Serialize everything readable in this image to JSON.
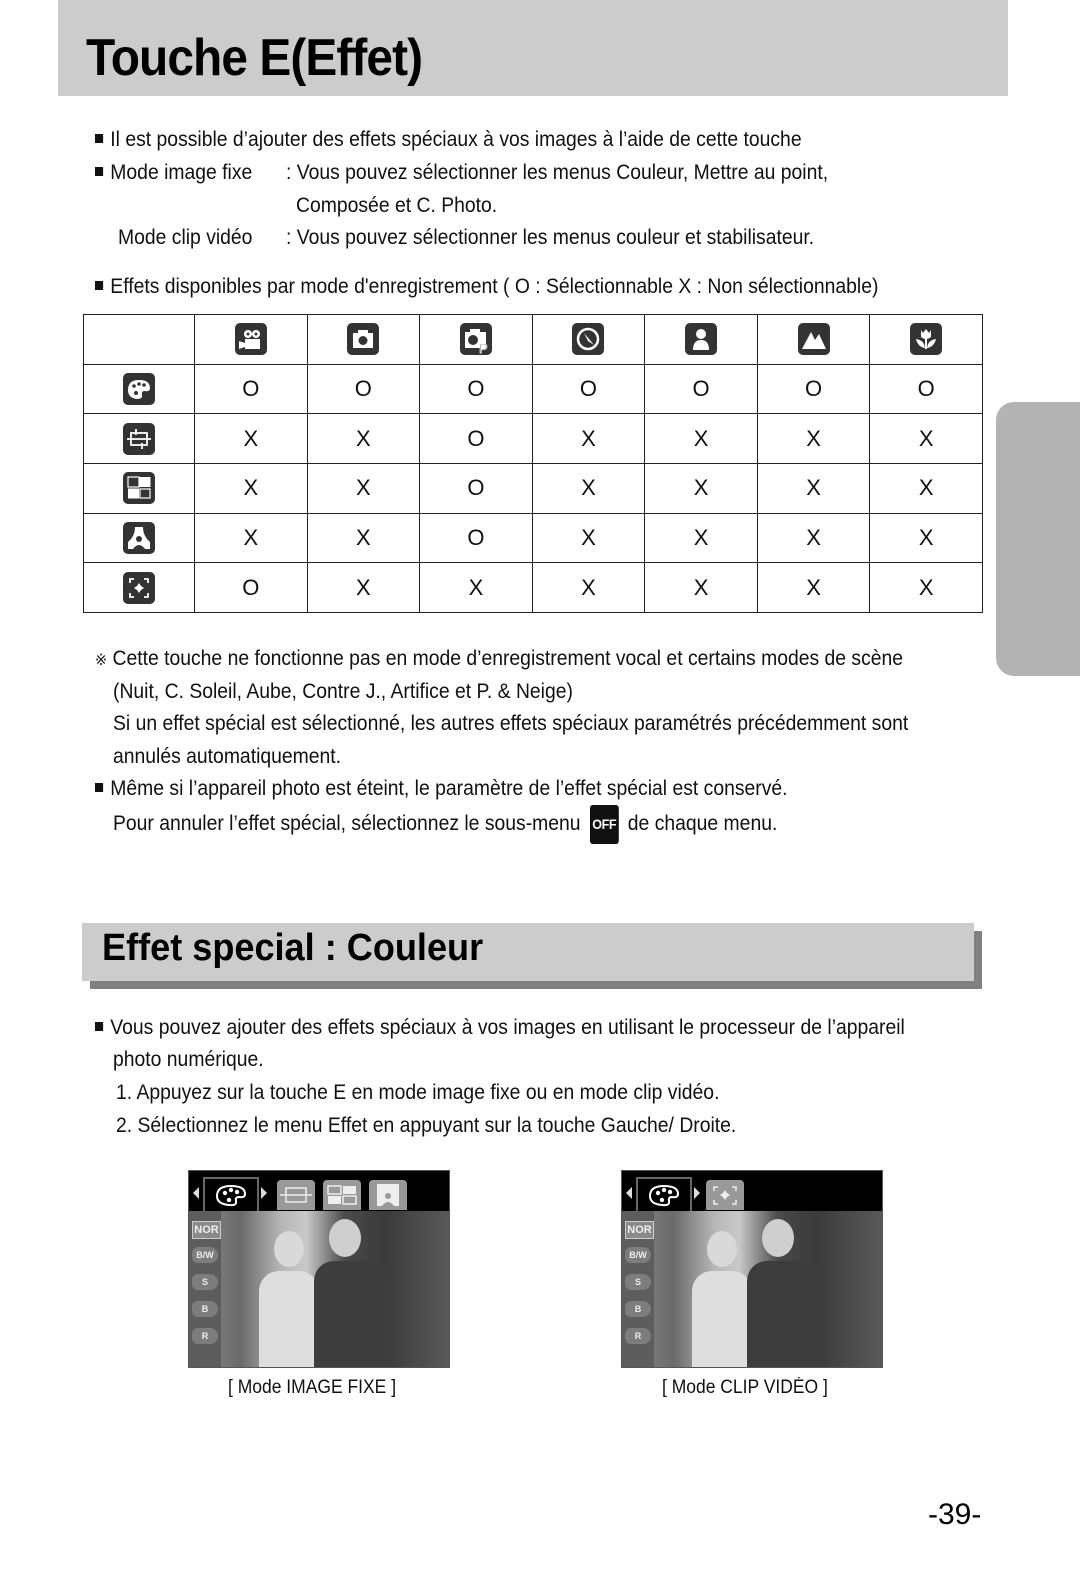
{
  "page": {
    "title": "Touche E(Effet)",
    "page_number": "-39-"
  },
  "intro": {
    "line1": "Il est possible d’ajouter des effets spéciaux à vos images à l’aide de cette touche",
    "mode_still_label": "Mode image fixe",
    "mode_still_text": ": Vous pouvez sélectionner les menus Couleur, Mettre au point,",
    "mode_still_text2": "Composée et C. Photo.",
    "mode_video_label": "Mode clip vidéo",
    "mode_video_text": ": Vous pouvez sélectionner les menus couleur et stabilisateur.",
    "table_caption": "Effets disponibles par mode d'enregistrement ( O : Sélectionnable X : Non sélectionnable)"
  },
  "table": {
    "columns": [
      {
        "icon": "movie-clip-icon"
      },
      {
        "icon": "auto-camera-icon"
      },
      {
        "icon": "program-camera-icon"
      },
      {
        "icon": "night-scene-icon"
      },
      {
        "icon": "portrait-icon"
      },
      {
        "icon": "landscape-icon"
      },
      {
        "icon": "macro-flower-icon"
      }
    ],
    "rows": [
      {
        "icon": "color-palette-icon",
        "cells": [
          "O",
          "O",
          "O",
          "O",
          "O",
          "O",
          "O"
        ]
      },
      {
        "icon": "highlight-frame-icon",
        "cells": [
          "X",
          "X",
          "O",
          "X",
          "X",
          "X",
          "X"
        ]
      },
      {
        "icon": "composite-icon",
        "cells": [
          "X",
          "X",
          "O",
          "X",
          "X",
          "X",
          "X"
        ]
      },
      {
        "icon": "photo-frame-icon",
        "cells": [
          "X",
          "X",
          "O",
          "X",
          "X",
          "X",
          "X"
        ]
      },
      {
        "icon": "stabilizer-icon",
        "cells": [
          "O",
          "X",
          "X",
          "X",
          "X",
          "X",
          "X"
        ]
      }
    ]
  },
  "notes": {
    "note1_line1": "Cette touche ne fonctionne pas en mode d’enregistrement vocal et certains modes de scène",
    "note1_line2": "(Nuit, C. Soleil, Aube, Contre J., Artifice et P. & Neige)",
    "note1_line3": "Si un effet spécial est sélectionné, les autres effets spéciaux paramétrés précédemment sont",
    "note1_line4": "annulés automatiquement.",
    "note2_line1": "Même si l’appareil photo est éteint, le paramètre de l’effet spécial est conservé.",
    "note2_line2a": "Pour annuler l’effet spécial, sélectionnez le sous-menu",
    "note2_off": "OFF",
    "note2_line2b": "de chaque menu."
  },
  "section": {
    "title": "Effet special : Couleur",
    "line1": "Vous pouvez ajouter des effets spéciaux à vos images en utilisant le processeur de l’appareil",
    "line2": "photo numérique.",
    "step1": "1. Appuyez sur la touche E en mode image fixe ou en mode clip vidéo.",
    "step2": "2. Sélectionnez le menu Effet en appuyant sur la touche Gauche/ Droite."
  },
  "screens": [
    {
      "caption": "[ Mode IMAGE FIXE ]",
      "menu_items": [
        "NOR",
        "B/W",
        "S",
        "B",
        "R"
      ]
    },
    {
      "caption": "[ Mode CLIP VIDÉO ]",
      "menu_items": [
        "NOR",
        "B/W",
        "S",
        "B",
        "R"
      ]
    }
  ]
}
